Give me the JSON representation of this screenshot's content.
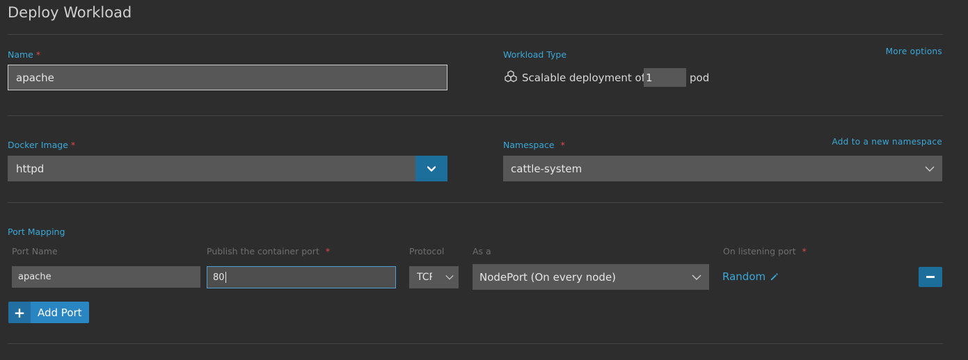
{
  "page": {
    "title": "Deploy Workload"
  },
  "name": {
    "label": "Name",
    "required": "*",
    "value": "apache"
  },
  "workload_type": {
    "label": "Workload Type",
    "more_options": "More options",
    "prefix": "Scalable deployment of",
    "count": "1",
    "suffix": "pod",
    "icon": "cubes-icon"
  },
  "docker_image": {
    "label": "Docker Image",
    "required": "*",
    "value": "httpd",
    "icon": "chevron-down-icon"
  },
  "namespace": {
    "label": "Namespace",
    "required": "*",
    "add_link": "Add to a new namespace",
    "value": "cattle-system"
  },
  "port_mapping": {
    "label": "Port Mapping",
    "columns": {
      "port_name": "Port Name",
      "publish": "Publish the container port",
      "publish_required": "*",
      "protocol": "Protocol",
      "as_a": "As a",
      "listening": "On listening port",
      "listening_required": "*"
    },
    "row": {
      "port_name": "apache",
      "container_port": "80",
      "protocol": "TCP",
      "as_a": "NodePort (On every node)",
      "listening": "Random"
    },
    "add_port": "Add Port"
  },
  "colors": {
    "accent": "#3aa8d8",
    "button": "#1c6e9b",
    "required": "#e04a4a",
    "background": "#2d2d2d"
  }
}
